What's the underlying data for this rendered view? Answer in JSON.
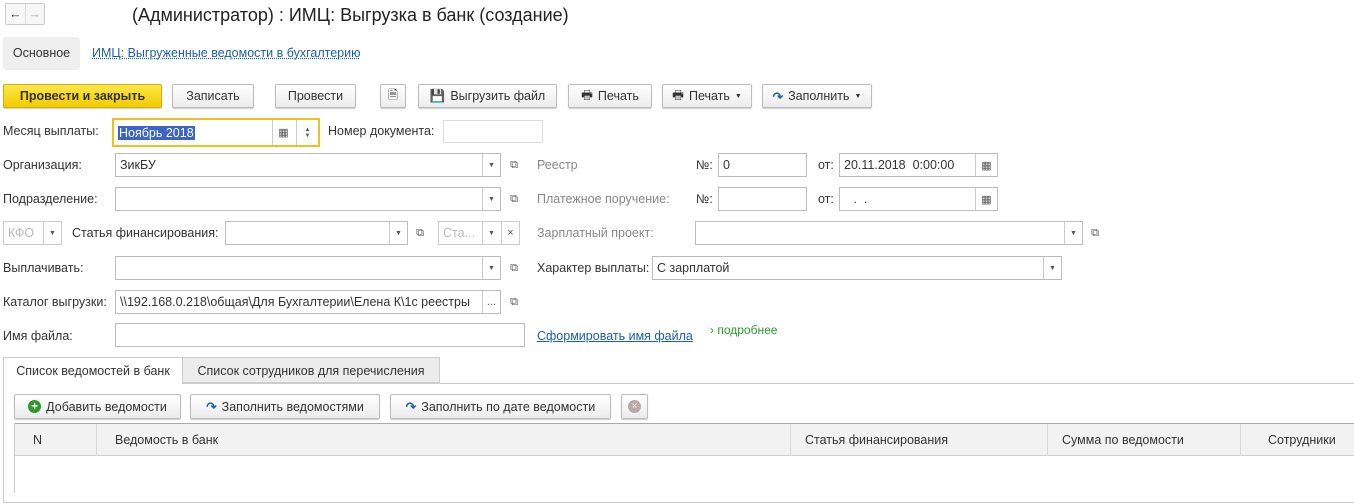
{
  "window": {
    "title": "(Администратор) : ИМЦ: Выгрузка в банк (создание)"
  },
  "nav": {
    "back": "←",
    "forward": "→"
  },
  "sections": {
    "main": "Основное",
    "link": "ИМЦ: Выгруженные ведомости в бухгалтерию"
  },
  "toolbar": {
    "post_close": "Провести и закрыть",
    "save": "Записать",
    "post": "Провести",
    "export": "Выгрузить файл",
    "print": "Печать",
    "print_menu": "Печать",
    "fill": "Заполнить"
  },
  "form": {
    "month_label": "Месяц выплаты:",
    "month_value": "Ноябрь 2018",
    "docnum_label": "Номер документа:",
    "docnum_value": "",
    "org_label": "Организация:",
    "org_value": "ЗикБУ",
    "registry_label": "Реестр",
    "registry_num_label": "№:",
    "registry_num": "0",
    "registry_from_label": "от:",
    "registry_date": "20.11.2018  0:00:00",
    "dept_label": "Подразделение:",
    "dept_value": "",
    "payorder_label": "Платежное поручение:",
    "payorder_num_label": "№:",
    "payorder_num": "",
    "payorder_from_label": "от:",
    "payorder_date": " .  .",
    "kfo_placeholder": "КФО",
    "fin_label": "Статья финансирования:",
    "fin_value": "",
    "sta_placeholder": "Ста...",
    "clear": "×",
    "salary_project_label": "Зарплатный проект:",
    "salary_project_value": "",
    "pay_label": "Выплачивать:",
    "pay_value": "",
    "pay_type_label": "Характер выплаты:",
    "pay_type_value": "С зарплатой",
    "catalog_label": "Каталог выгрузки:",
    "catalog_value": "\\\\192.168.0.218\\общая\\Для Бухгалтерии\\Елена К\\1с реестры",
    "catalog_more": "...",
    "filename_label": "Имя файла:",
    "filename_value": "",
    "make_filename": "Сформировать имя файла",
    "more": "подробнее"
  },
  "tabs": [
    "Список ведомостей в банк",
    "Список сотрудников для перечисления"
  ],
  "table_toolbar": {
    "add": "Добавить ведомости",
    "fill_lists": "Заполнить ведомостями",
    "fill_date": "Заполнить по дате ведомости"
  },
  "table": {
    "columns": [
      "N",
      "Ведомость в банк",
      "Статья финансирования",
      "Сумма по ведомости",
      "Сотрудники"
    ],
    "rows": []
  },
  "colors": {
    "accent": "#f2cc00",
    "focus": "#f0c020",
    "link": "#1d5fa8",
    "green": "#2a9a2a"
  }
}
